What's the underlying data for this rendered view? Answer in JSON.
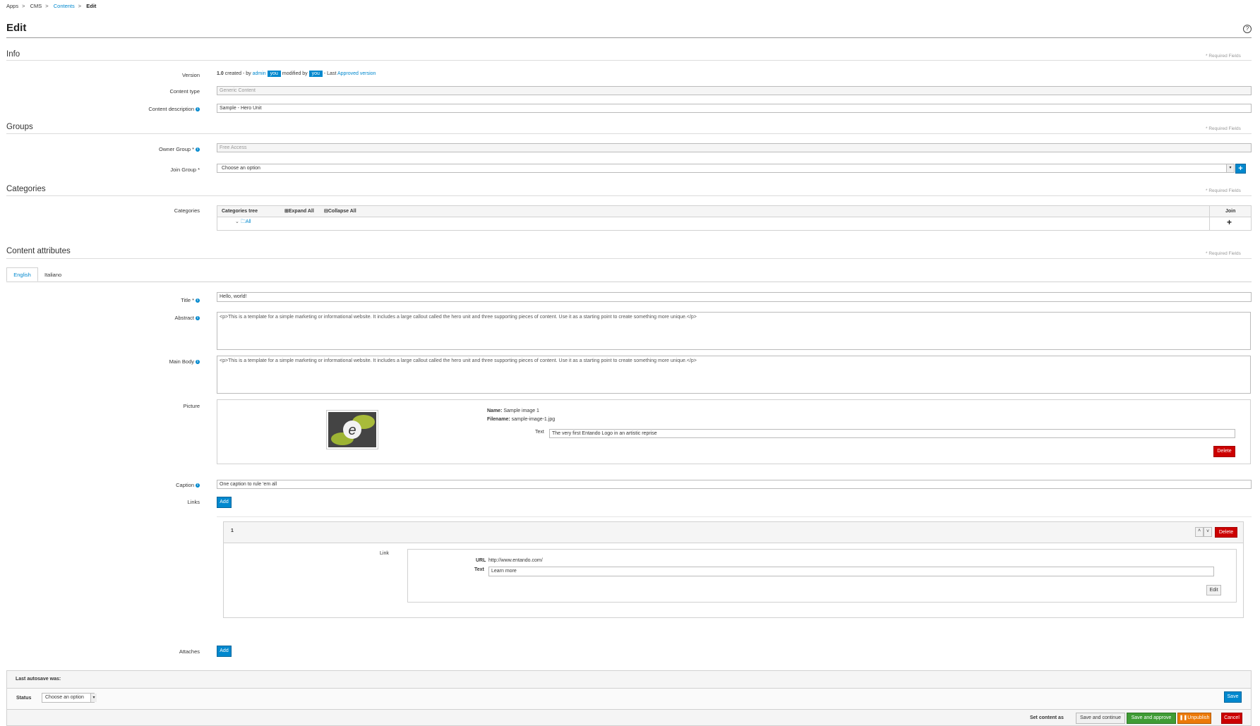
{
  "breadcrumb": {
    "items": [
      "Apps",
      "CMS",
      "Contents"
    ],
    "current": "Edit"
  },
  "page": {
    "title": "Edit"
  },
  "info": {
    "section_title": "Info",
    "required_note": "* Required Fields",
    "version_label": "Version",
    "version_number": "1.0",
    "created_by_text": "created - by",
    "created_by_user": "admin",
    "you_badge": "you",
    "modified_by_text": "modified by",
    "last_text": "- Last",
    "approved_link": "Approved version",
    "content_type_label": "Content type",
    "content_type_value": "Generic Content",
    "content_description_label": "Content description",
    "content_description_value": "Sample - Hero Unit"
  },
  "groups": {
    "section_title": "Groups",
    "required_note": "* Required Fields",
    "owner_group_label": "Owner Group",
    "owner_group_value": "Free Access",
    "join_group_label": "Join Group",
    "join_group_placeholder": "Choose an option"
  },
  "categories": {
    "section_title": "Categories",
    "required_note": "* Required Fields",
    "label": "Categories",
    "tree_header": "Categories tree",
    "expand_all": "Expand All",
    "collapse_all": "Collapse All",
    "join_header": "Join",
    "root_node": "All"
  },
  "attributes": {
    "section_title": "Content attributes",
    "required_note": "* Required Fields",
    "tabs": [
      "English",
      "Italiano"
    ],
    "title_label": "Title",
    "title_value": "Hello, world!",
    "abstract_label": "Abstract",
    "abstract_value": "<p>This is a template for a simple marketing or informational website. It includes a large callout called the hero unit and three supporting pieces of content. Use it as a starting point to create something more unique.</p>",
    "main_body_label": "Main Body",
    "main_body_value": "<p>This is a template for a simple marketing or informational website. It includes a large callout called the hero unit and three supporting pieces of content. Use it as a starting point to create something more unique.</p>",
    "picture_label": "Picture",
    "picture_name_label": "Name:",
    "picture_name_value": "Sample image 1",
    "picture_filename_label": "Filename:",
    "picture_filename_value": "sample-image-1.jpg",
    "picture_text_label": "Text",
    "picture_text_value": "The very first Entando Logo in an artistic reprise",
    "delete_label": "Delete",
    "caption_label": "Caption",
    "caption_value": "One caption to rule 'em all",
    "links_label": "Links",
    "add_label": "Add",
    "link_item_index": "1",
    "link_label": "Link",
    "url_label": "URL",
    "url_value": "http://www.entando.com/",
    "link_text_label": "Text",
    "link_text_value": "Learn more",
    "edit_label": "Edit",
    "attaches_label": "Attaches"
  },
  "footer": {
    "autosave_label": "Last autosave was:",
    "status_label": "Status",
    "status_placeholder": "Choose an option",
    "save_label": "Save",
    "set_content_as": "Set content as",
    "save_continue": "Save and continue",
    "save_approve": "Save and approve",
    "unpublish": "Unpublish",
    "cancel": "Cancel"
  },
  "icons": [
    "help-icon",
    "info-icon",
    "plus-icon",
    "folder-icon",
    "chevron-down-icon",
    "caret-up-icon",
    "caret-down-icon",
    "pause-icon",
    "entando-logo"
  ],
  "colors": {
    "primary": "#0088ce",
    "danger": "#cc0000",
    "success": "#3f9c35",
    "warning": "#ec7a08"
  }
}
